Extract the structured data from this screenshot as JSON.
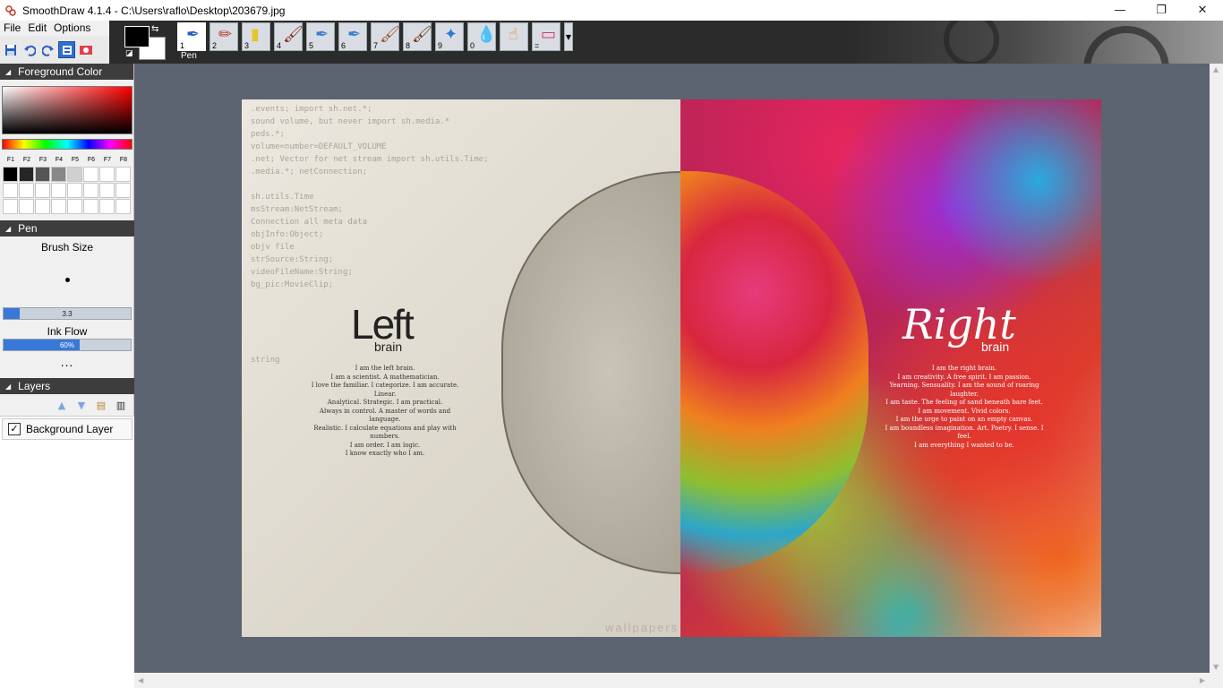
{
  "window": {
    "title": "SmoothDraw 4.1.4 - C:\\Users\\raflo\\Desktop\\203679.jpg",
    "minimize": "—",
    "maximize": "❐",
    "close": "✕"
  },
  "menu": [
    "File",
    "Edit",
    "Options"
  ],
  "quick_tools": [
    {
      "name": "save-icon",
      "glyph": "💾"
    },
    {
      "name": "undo-icon",
      "glyph": "↶"
    },
    {
      "name": "redo-icon",
      "glyph": "↷"
    },
    {
      "name": "view-mode-icon",
      "glyph": "▤"
    },
    {
      "name": "record-icon",
      "glyph": "⏺"
    }
  ],
  "brushes": [
    {
      "num": "1",
      "name": "pen",
      "glyph": "✒",
      "color": "#2b5fbf"
    },
    {
      "num": "2",
      "name": "pencil",
      "glyph": "✏",
      "color": "#c0392b"
    },
    {
      "num": "3",
      "name": "highlighter",
      "glyph": "▮",
      "color": "#e5c52b"
    },
    {
      "num": "4",
      "name": "brush",
      "glyph": "🖌",
      "color": "#8b2a1a"
    },
    {
      "num": "5",
      "name": "airbrush",
      "glyph": "✒",
      "color": "#3a7fd0"
    },
    {
      "num": "6",
      "name": "watercolor",
      "glyph": "✒",
      "color": "#3a7fd0"
    },
    {
      "num": "7",
      "name": "oil-brush",
      "glyph": "🖌",
      "color": "#a0522d"
    },
    {
      "num": "8",
      "name": "marker",
      "glyph": "🖌",
      "color": "#6b3a1a"
    },
    {
      "num": "9",
      "name": "star-brush",
      "glyph": "✦",
      "color": "#2e7bd6"
    },
    {
      "num": "0",
      "name": "water-drop",
      "glyph": "💧",
      "color": "#3a7fd0"
    },
    {
      "num": "",
      "name": "hand",
      "glyph": "☝",
      "color": "#e08a2a"
    },
    {
      "num": "=",
      "name": "eraser",
      "glyph": "▭",
      "color": "#d43a6a"
    }
  ],
  "brush_caption": "Pen",
  "panels": {
    "foreground_color": "Foreground Color",
    "pen": "Pen",
    "layers": "Layers"
  },
  "fkeys": [
    "F1",
    "F2",
    "F3",
    "F4",
    "F5",
    "F6",
    "F7",
    "F8"
  ],
  "palette_colors": [
    "#000000",
    "#262626",
    "#555555",
    "#888888",
    "#d0d0d0",
    "#ffffff",
    "#ffffff",
    "#ffffff",
    "#ffffff",
    "#ffffff",
    "#ffffff",
    "#ffffff",
    "#ffffff",
    "#ffffff",
    "#ffffff",
    "#ffffff",
    "#ffffff",
    "#ffffff",
    "#ffffff",
    "#ffffff",
    "#ffffff",
    "#ffffff",
    "#ffffff",
    "#ffffff"
  ],
  "pen": {
    "brush_size_label": "Brush Size",
    "brush_size_value": "3.3",
    "brush_size_fraction": 0.13,
    "ink_flow_label": "Ink Flow",
    "ink_flow_value": "60%",
    "ink_flow_fraction": 0.6,
    "more": "..."
  },
  "layers": {
    "items": [
      {
        "name": "Background Layer",
        "checked": true
      }
    ]
  },
  "image": {
    "left_title": "Left",
    "left_sub": "brain",
    "left_text": "I am the left brain.\nI am a scientist. A mathematician.\nI love the familiar. I categorize. I am accurate. Linear.\nAnalytical. Strategic. I am practical.\nAlways in control. A master of words and language.\nRealistic. I calculate equations and play with numbers.\nI am order. I am logic.\nI know exactly who I am.",
    "right_title": "Right",
    "right_sub": "brain",
    "right_text": "I am the right brain.\nI am creativity. A free spirit. I am passion.\nYearning. Sensuality. I am the sound of roaring laughter.\nI am taste. The feeling of sand beneath bare feet.\nI am movement. Vivid colors.\nI am the urge to paint on an empty canvas.\nI am boundless imagination. Art. Poetry. I sense. I feel.\nI am everything I wanted to be.",
    "code_lines": ".events; import sh.net.*;\nsound volume, but never import sh.media.*\npeds.*;\nvolume=number=DEFAULT_VOLUME\n.net; Vector for net stream import sh.utils.Time;\n.media.*; netConnection;\n\nsh.utils.Time\nmsStream:NetStream;\nConnection all meta data\nobjInfo:Object;\nobjv file\nstrSource:String;\nvideoFileName:String;\nbg_pic:MovieClip;\n\n\n\n\n\nstring",
    "watermark": "wallpapers"
  }
}
